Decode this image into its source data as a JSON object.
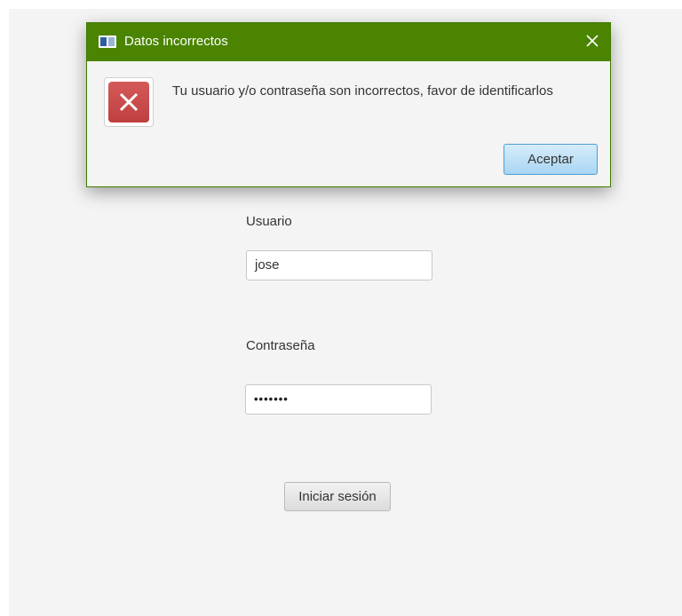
{
  "form": {
    "username_label": "Usuario",
    "username_value": "jose",
    "password_label": "Contraseña",
    "password_masked": "•••••••",
    "login_button_label": "Iniciar sesión"
  },
  "dialog": {
    "title": "Datos incorrectos",
    "message": "Tu usuario y/o contraseña son incorrectos, favor de identificarlos",
    "accept_label": "Aceptar",
    "titlebar_color": "#4a8400",
    "error_icon": "error-x-icon",
    "close_icon": "close-icon"
  }
}
